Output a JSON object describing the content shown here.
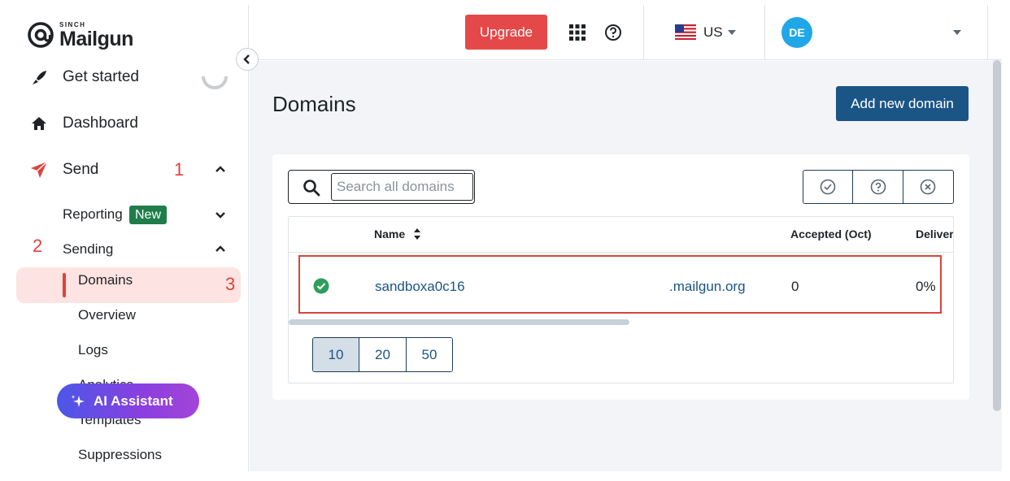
{
  "brand": {
    "sinch": "SINCH",
    "name": "Mailgun"
  },
  "sidebar": {
    "get_started": "Get started",
    "dashboard": "Dashboard",
    "send": "Send",
    "reporting": "Reporting",
    "new_badge": "New",
    "sending": "Sending",
    "domains": "Domains",
    "overview": "Overview",
    "logs": "Logs",
    "analytics": "Analytics",
    "templates": "Templates",
    "suppressions": "Suppressions",
    "ai_assistant": "AI Assistant"
  },
  "annotations": {
    "one": "1",
    "two": "2",
    "three": "3"
  },
  "header": {
    "upgrade": "Upgrade",
    "region": "US",
    "avatar_initials": "DE"
  },
  "main": {
    "title": "Domains",
    "add_button": "Add new domain",
    "search_placeholder": "Search all domains",
    "columns": {
      "name": "Name",
      "accepted": "Accepted (Oct)",
      "delivered": "Deliver"
    },
    "row": {
      "name": "sandboxa0c16",
      "suffix": ".mailgun.org",
      "accepted": "0",
      "delivered": "0%",
      "status": "verified"
    },
    "page_sizes": [
      "10",
      "20",
      "50"
    ],
    "active_page_size": "10"
  },
  "colors": {
    "accent_red": "#e54848",
    "primary_blue": "#1a5585",
    "new_badge": "#1e7d4a",
    "avatar": "#20a7e8",
    "active_nav_bg": "#fde3e1"
  },
  "icons": [
    "mailgun-at-logo-icon",
    "rocket-icon",
    "spinner-icon",
    "home-icon",
    "paper-plane-icon",
    "chevron-up-icon",
    "chevron-down-icon",
    "chevron-left-icon",
    "sparkle-icon",
    "apps-grid-icon",
    "help-circle-icon",
    "us-flag-icon",
    "caret-down-icon",
    "search-icon",
    "check-circle-filter-icon",
    "question-circle-filter-icon",
    "x-circle-filter-icon",
    "sort-icon",
    "verified-check-icon"
  ]
}
